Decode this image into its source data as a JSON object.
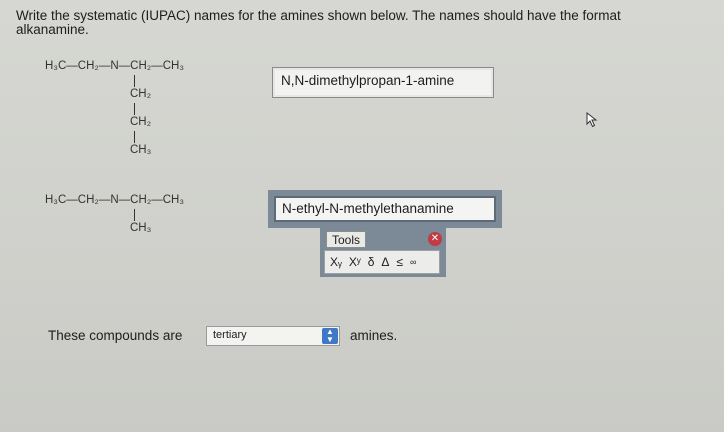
{
  "instructions": "Write the systematic (IUPAC) names for the amines shown below. The names should have the format alkanamine.",
  "structure1": {
    "main": "H₃C—CH₂—N—CH₂—CH₃",
    "branch": [
      "CH₂",
      "CH₂",
      "CH₃"
    ]
  },
  "answer1": "N,N-dimethylpropan-1-amine",
  "structure2": {
    "main": "H₃C—CH₂—N—CH₂—CH₃",
    "branch": "CH₃"
  },
  "answer2": "N-ethyl-N-methylethanamine",
  "tools": {
    "tab_label": "Tools",
    "buttons": [
      "Xᵧ",
      "Xʸ",
      "δ",
      "Δ",
      "≤",
      "∞"
    ]
  },
  "bottom": {
    "prefix": "These compounds are",
    "select_value": "tertiary",
    "suffix": "amines."
  },
  "colors": {
    "panel": "#7b8a96",
    "select_arrow": "#3f78c7"
  }
}
